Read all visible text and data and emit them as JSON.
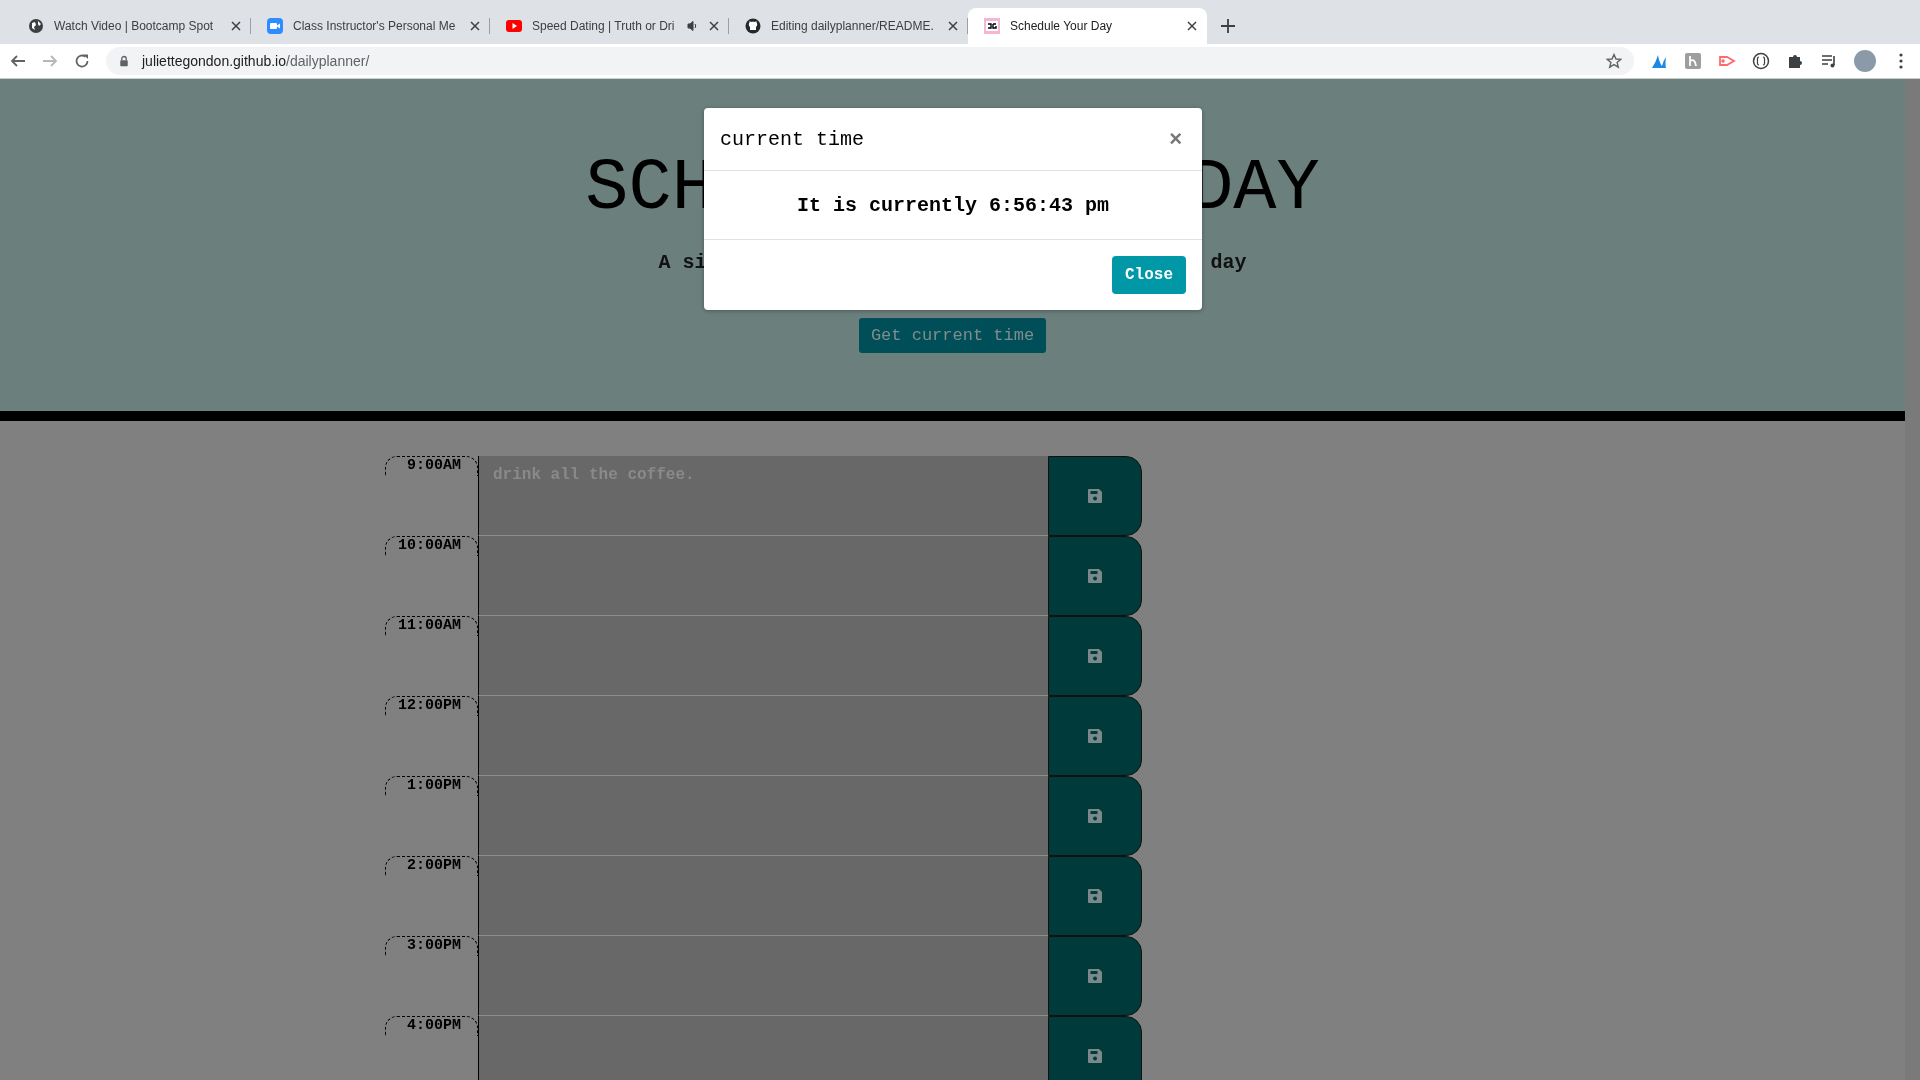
{
  "browser": {
    "tabs": [
      {
        "title": "Watch Video | Bootcamp Spot",
        "kind": "globe",
        "selected": false,
        "audio": false
      },
      {
        "title": "Class Instructor's Personal Me",
        "kind": "video",
        "selected": false,
        "audio": false
      },
      {
        "title": "Speed Dating | Truth or Dri",
        "kind": "play",
        "selected": false,
        "audio": true
      },
      {
        "title": "Editing dailyplanner/README.",
        "kind": "octocat",
        "selected": false,
        "audio": false
      },
      {
        "title": "Schedule Your Day",
        "kind": "monogram",
        "selected": true,
        "audio": false
      }
    ],
    "url_host": "juliettegondon.github.io",
    "url_path": "/dailyplanner/"
  },
  "header": {
    "title_left": "SCH",
    "title_right": "DAY",
    "subtitle_left": "A si",
    "subtitle_right": "day",
    "button": "Get current time"
  },
  "rows": [
    {
      "hour": "9:00AM",
      "text": "drink all the coffee."
    },
    {
      "hour": "10:00AM"
    },
    {
      "hour": "11:00AM"
    },
    {
      "hour": "12:00PM"
    },
    {
      "hour": "1:00PM"
    },
    {
      "hour": "2:00PM"
    },
    {
      "hour": "3:00PM"
    },
    {
      "hour": "4:00PM"
    }
  ],
  "modal": {
    "title": "current time",
    "close_glyph": "×",
    "message": "It is currently 6:56:43 pm",
    "button": "Close"
  }
}
